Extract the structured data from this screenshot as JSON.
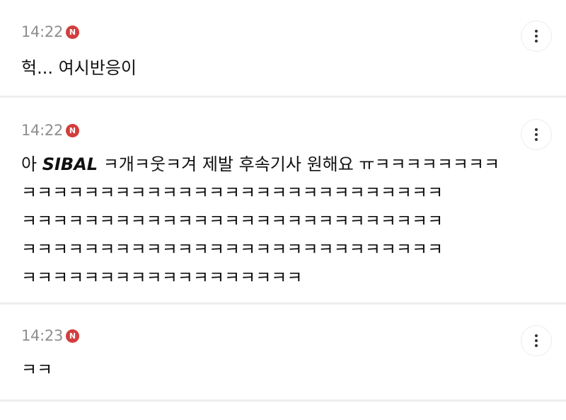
{
  "comments": [
    {
      "time": "14:22",
      "badge": "N",
      "text": "헉... 여시반응이"
    },
    {
      "time": "14:22",
      "badge": "N",
      "text_prefix": "아 ",
      "text_bold": "SIBAL",
      "text_suffix": " ㅋ개ㅋ웃ㅋ겨 제발 후속기사 원해요 ㅠㅋㅋㅋㅋㅋㅋㅋㅋ",
      "lines": [
        "ㅋㅋㅋㅋㅋㅋㅋㅋㅋㅋㅋㅋㅋㅋㅋㅋㅋㅋㅋㅋㅋㅋㅋㅋㅋㅋㅋ",
        "ㅋㅋㅋㅋㅋㅋㅋㅋㅋㅋㅋㅋㅋㅋㅋㅋㅋㅋㅋㅋㅋㅋㅋㅋㅋㅋㅋ",
        "ㅋㅋㅋㅋㅋㅋㅋㅋㅋㅋㅋㅋㅋㅋㅋㅋㅋㅋㅋㅋㅋㅋㅋㅋㅋㅋㅋ",
        "ㅋㅋㅋㅋㅋㅋㅋㅋㅋㅋㅋㅋㅋㅋㅋㅋㅋㅋ"
      ]
    },
    {
      "time": "14:23",
      "badge": "N",
      "text": "ㅋㅋ"
    }
  ],
  "icons": {
    "more": "more-vertical-icon",
    "new_badge": "new-badge-icon"
  },
  "colors": {
    "badge": "#d33d3d",
    "time": "#8e8e8e",
    "divider": "#eeeeee"
  }
}
